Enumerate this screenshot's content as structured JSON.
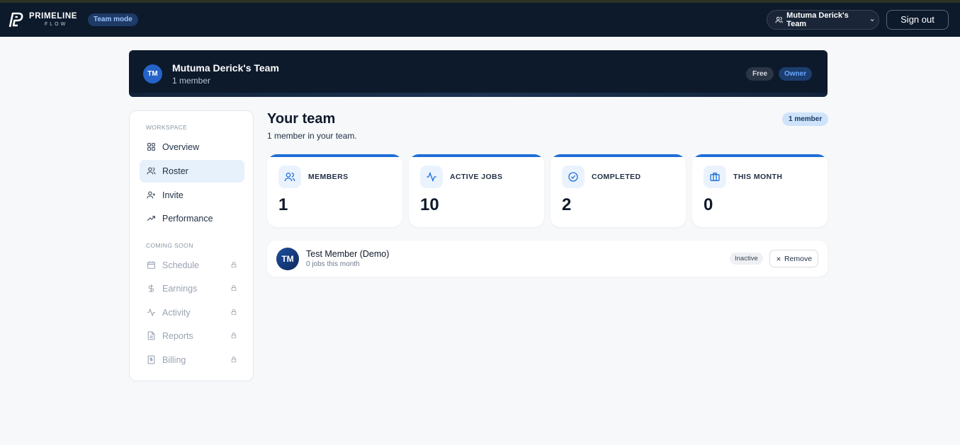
{
  "header": {
    "logo_line1": "PRIMELINE",
    "logo_line2": "FLOW",
    "mode_badge": "Team mode",
    "team_selector": "Mutuma Derick's Team",
    "sign_out": "Sign out"
  },
  "banner": {
    "avatar_initials": "TM",
    "team_name": "Mutuma Derick's Team",
    "member_count": "1 member",
    "plan_badge": "Free",
    "role_badge": "Owner"
  },
  "sidebar": {
    "workspace_heading": "WORKSPACE",
    "workspace_items": [
      {
        "label": "Overview",
        "icon": "grid-icon"
      },
      {
        "label": "Roster",
        "icon": "users-icon",
        "active": true
      },
      {
        "label": "Invite",
        "icon": "user-plus-icon"
      },
      {
        "label": "Performance",
        "icon": "trending-up-icon"
      }
    ],
    "coming_soon_heading": "COMING SOON",
    "coming_soon_items": [
      {
        "label": "Schedule",
        "icon": "calendar-icon"
      },
      {
        "label": "Earnings",
        "icon": "dollar-icon"
      },
      {
        "label": "Activity",
        "icon": "activity-icon"
      },
      {
        "label": "Reports",
        "icon": "file-icon"
      },
      {
        "label": "Billing",
        "icon": "receipt-icon"
      }
    ]
  },
  "main": {
    "title": "Your team",
    "subtitle": "1 member in your team.",
    "member_pill": "1 member",
    "stats": [
      {
        "label": "MEMBERS",
        "value": "1",
        "icon": "users-icon"
      },
      {
        "label": "ACTIVE JOBS",
        "value": "10",
        "icon": "activity-icon"
      },
      {
        "label": "COMPLETED",
        "value": "2",
        "icon": "check-circle-icon"
      },
      {
        "label": "THIS MONTH",
        "value": "0",
        "icon": "briefcase-icon"
      }
    ],
    "members": [
      {
        "initials": "TM",
        "name": "Test Member (Demo)",
        "jobs": "0 jobs this month",
        "status": "Inactive",
        "remove_label": "Remove"
      }
    ]
  },
  "colors": {
    "nav_bg": "#0d1a2c",
    "accent": "#1f6fd8",
    "page_bg": "#f7f8fa"
  }
}
